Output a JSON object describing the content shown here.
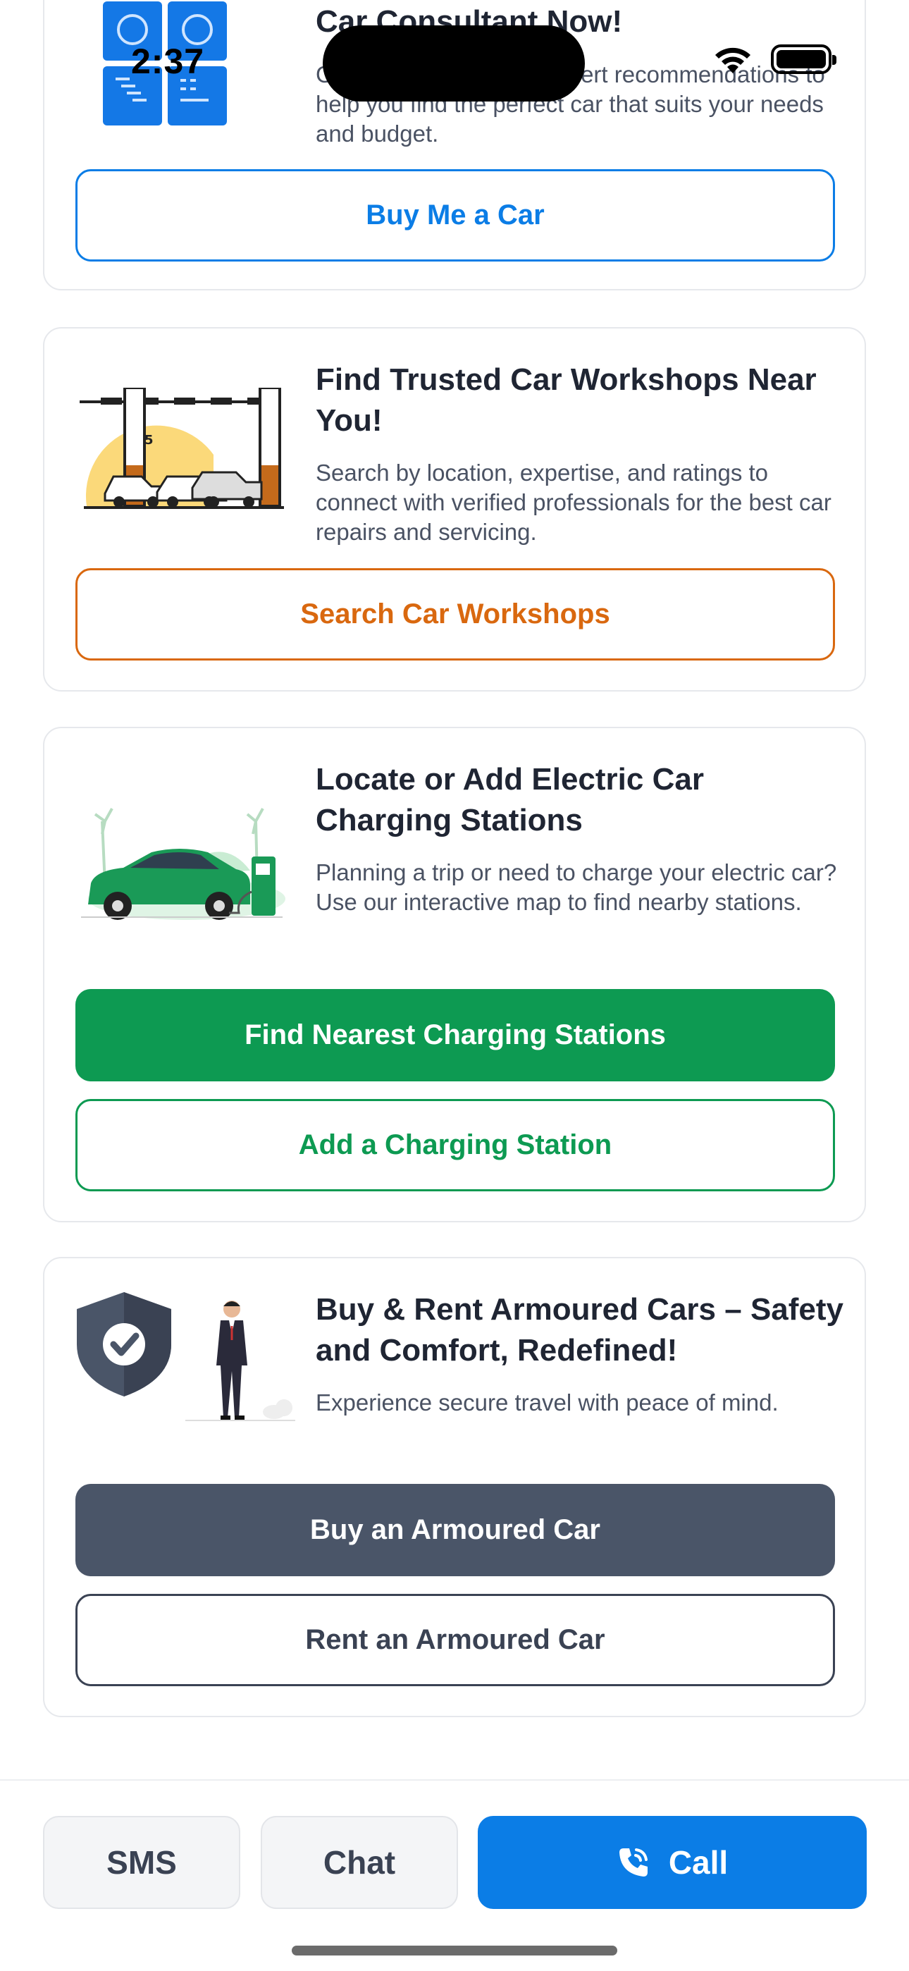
{
  "status_bar": {
    "time": "2:37"
  },
  "cards": {
    "consultant": {
      "title": "Car Consultant Now!",
      "description": "Get personalized and expert recommendations to help you find the perfect car that suits your needs and budget.",
      "button_label": "Buy Me a Car"
    },
    "workshops": {
      "title": "Find Trusted Car Workshops Near You!",
      "description": "Search by location, expertise, and ratings to connect with verified professionals for the best car repairs and servicing.",
      "button_label": "Search Car Workshops"
    },
    "charging": {
      "title": "Locate or Add Electric Car Charging Stations",
      "description": "Planning a trip or need to charge your electric car? Use our interactive map to find nearby stations.",
      "primary_button_label": "Find Nearest Charging Stations",
      "secondary_button_label": "Add a Charging Station"
    },
    "armoured": {
      "title": "Buy & Rent Armoured Cars – Safety and Comfort, Redefined!",
      "description": "Experience secure travel with peace of mind.",
      "primary_button_label": "Buy an Armoured Car",
      "secondary_button_label": "Rent an Armoured Car"
    }
  },
  "bottom_bar": {
    "sms_label": "SMS",
    "chat_label": "Chat",
    "call_label": "Call"
  },
  "colors": {
    "blue": "#0b7de6",
    "orange": "#d9680f",
    "green": "#0d9a52",
    "slate": "#4a5568"
  }
}
